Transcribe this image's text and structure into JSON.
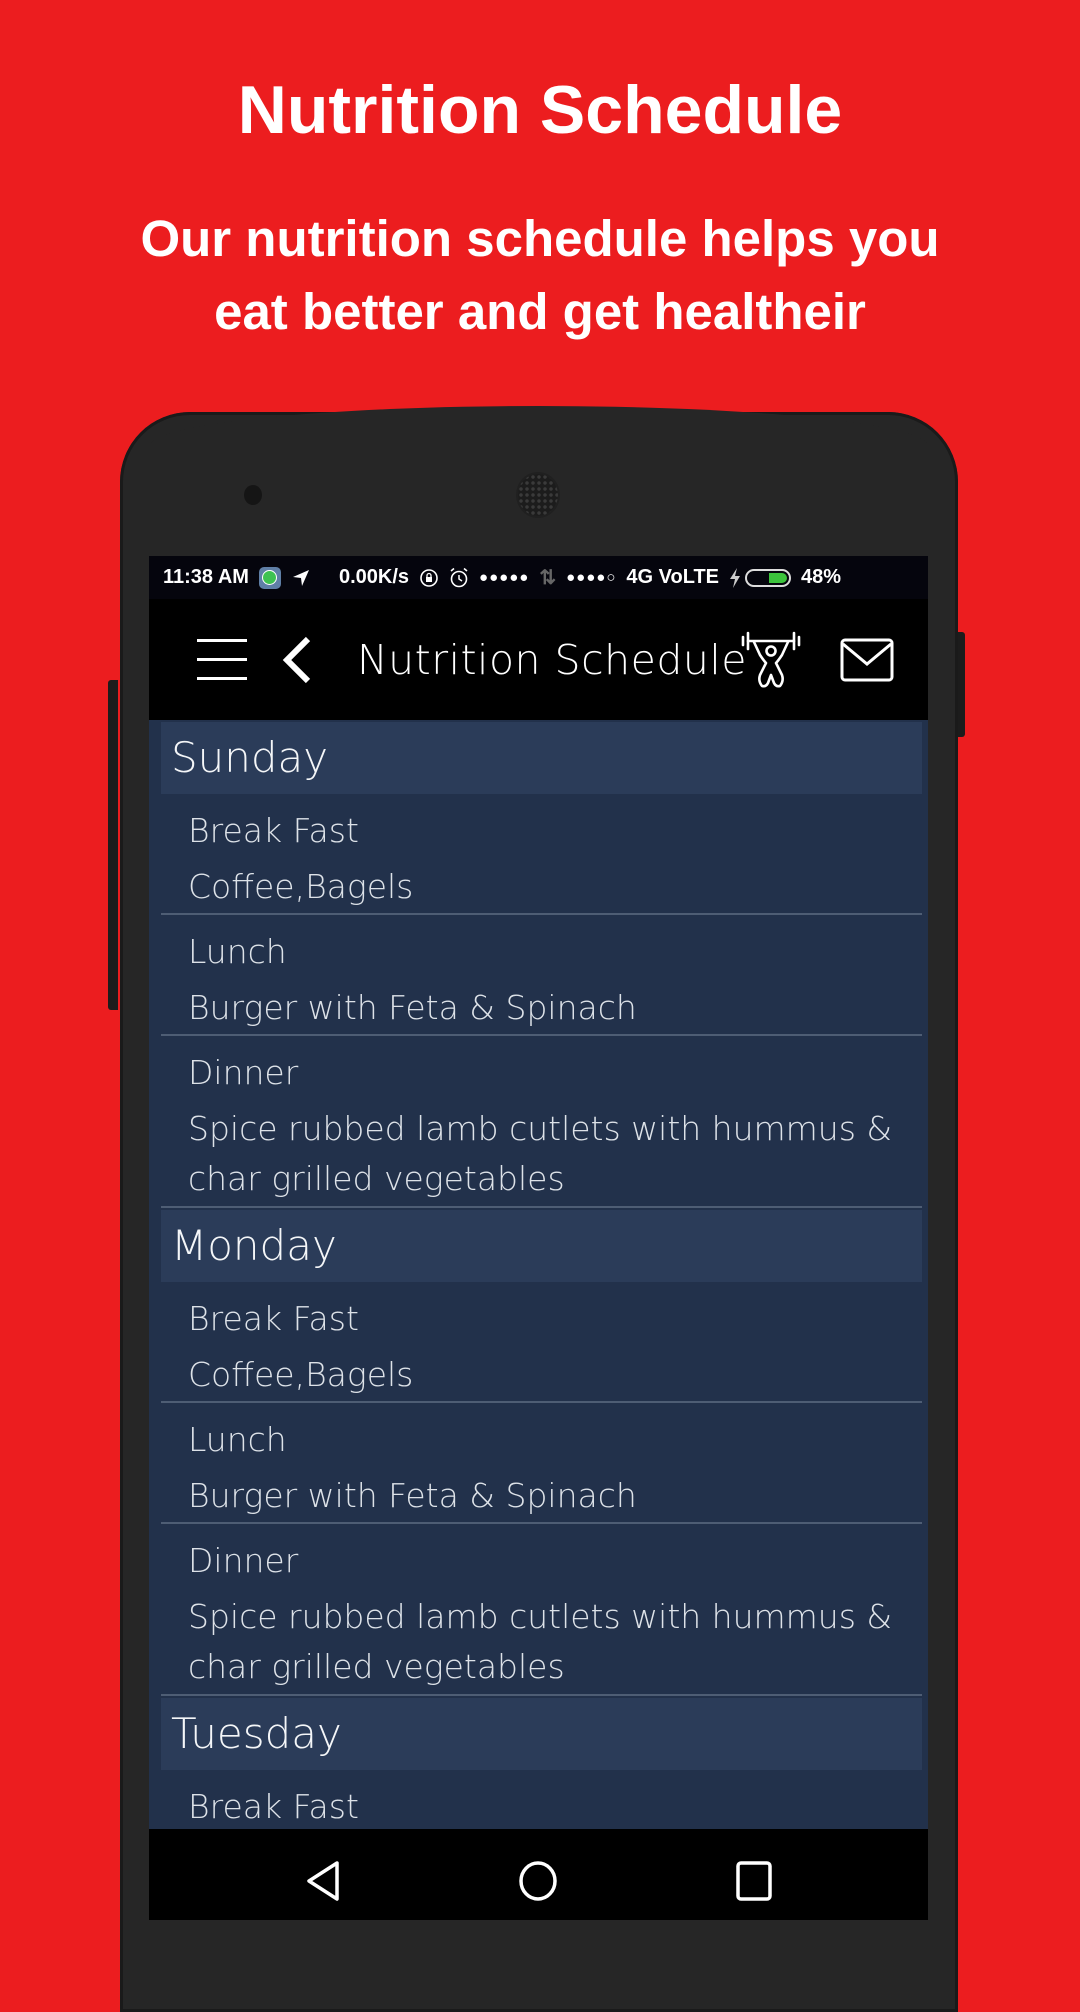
{
  "promo": {
    "title": "Nutrition Schedule",
    "subtitle_line1": "Our nutrition schedule helps you",
    "subtitle_line2": "eat better and get healtheir"
  },
  "colors": {
    "background": "#ec1d1f",
    "list_background": "#22314b",
    "day_header": "#2b3c59",
    "battery_fill": "#3cc33c"
  },
  "status_bar": {
    "time": "11:38 AM",
    "net_speed": "0.00K/s",
    "sim1_signal": "●●●●●",
    "sim2_signal": "●●●●○",
    "network": "4G VoLTE",
    "battery": "48%",
    "battery_level": 0.48,
    "icons": [
      "whatsapp-icon",
      "location-arrow-icon",
      "rotation-lock-icon",
      "alarm-icon",
      "data-transfer-icon",
      "charging-bolt-icon",
      "battery-icon"
    ]
  },
  "app_bar": {
    "title": "Nutrition Schedule",
    "icons": [
      "menu-icon",
      "back-chevron-icon",
      "weightlifter-icon",
      "mail-icon"
    ]
  },
  "schedule": [
    {
      "day": "Sunday",
      "meals": [
        {
          "name": "Break Fast",
          "food": "Coffee,Bagels"
        },
        {
          "name": "Lunch",
          "food": "Burger with Feta & Spinach"
        },
        {
          "name": "Dinner",
          "food": "Spice rubbed lamb cutlets with hummus & char grilled vegetables"
        }
      ]
    },
    {
      "day": "Monday",
      "meals": [
        {
          "name": "Break Fast",
          "food": "Coffee,Bagels"
        },
        {
          "name": "Lunch",
          "food": "Burger with Feta & Spinach"
        },
        {
          "name": "Dinner",
          "food": "Spice rubbed lamb cutlets with hummus & char grilled vegetables"
        }
      ]
    },
    {
      "day": "Tuesday",
      "meals": [
        {
          "name": "Break Fast",
          "food": ""
        }
      ]
    }
  ],
  "nav_bar": {
    "buttons": [
      "back-icon",
      "home-icon",
      "recents-icon"
    ]
  }
}
